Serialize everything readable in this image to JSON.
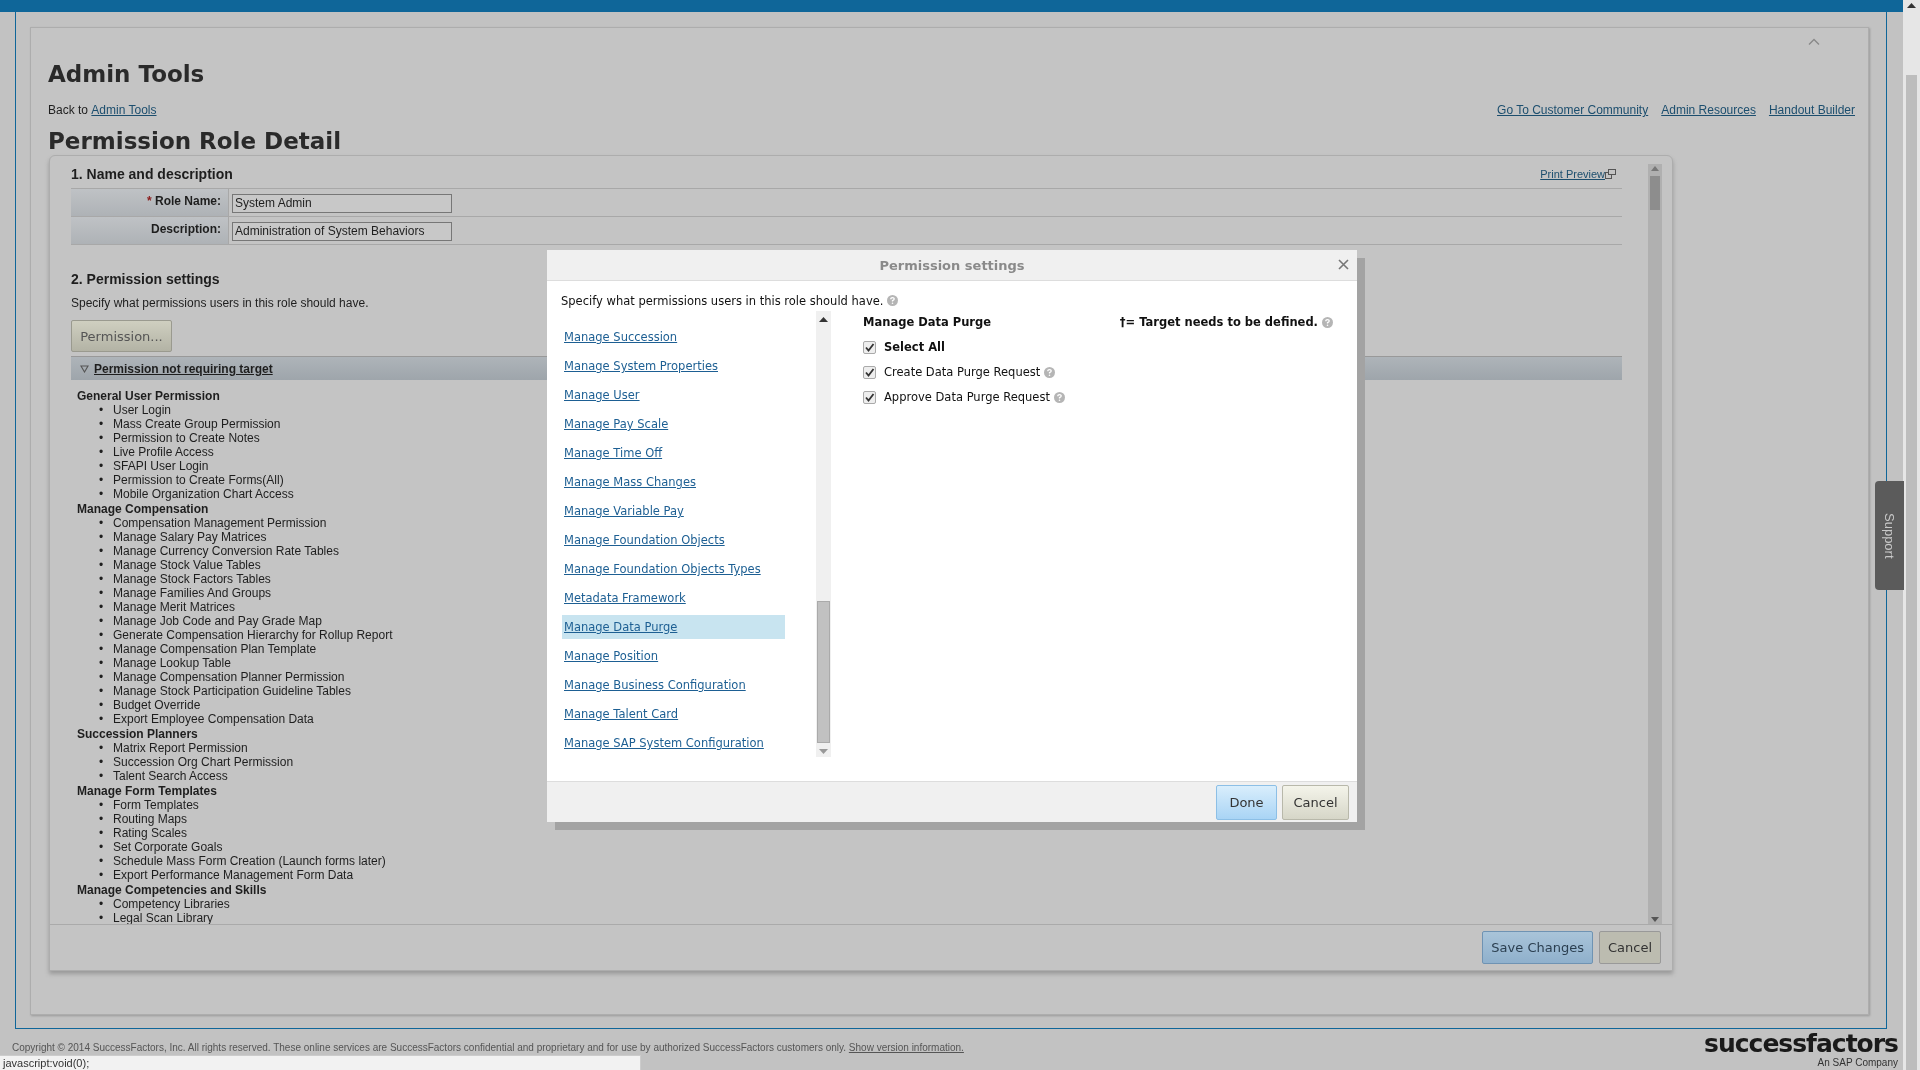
{
  "page_title": "Admin Tools",
  "nav": {
    "back_prefix": "Back to",
    "back_link": "Admin Tools",
    "links": [
      "Go To Customer Community",
      "Admin Resources",
      "Handout Builder"
    ]
  },
  "section_title": "Permission Role Detail",
  "role_form": {
    "heading": "1. Name and description",
    "print_preview": "Print Preview",
    "fields": [
      {
        "marker": "*",
        "label": "Role Name:",
        "value": "System Admin"
      },
      {
        "label": "Description:",
        "value": "Administration of System Behaviors"
      }
    ]
  },
  "permission_settings": {
    "heading": "2. Permission settings",
    "description": "Specify what permissions users in this role should have.",
    "button": "Permission...",
    "group_bar": {
      "label": "Permission not requiring target",
      "expanded": true
    },
    "bullet": "•",
    "groups": [
      {
        "name": "General User Permission",
        "items": [
          "User Login",
          "Mass Create Group Permission",
          "Permission to Create Notes",
          "Live Profile Access",
          "SFAPI User Login",
          "Permission to Create Forms(All)",
          "Mobile Organization Chart Access"
        ]
      },
      {
        "name": "Manage Compensation",
        "items": [
          "Compensation Management Permission",
          "Manage Salary Pay Matrices",
          "Manage Currency Conversion Rate Tables",
          "Manage Stock Value Tables",
          "Manage Stock Factors Tables",
          "Manage Families And Groups",
          "Manage Merit Matrices",
          "Manage Job Code and Pay Grade Map",
          "Generate Compensation Hierarchy for Rollup Report",
          "Manage Compensation Plan Template",
          "Manage Lookup Table",
          "Manage Compensation Planner Permission",
          "Manage Stock Participation Guideline Tables",
          "Budget Override",
          "Export Employee Compensation Data"
        ]
      },
      {
        "name": "Succession Planners",
        "items": [
          "Matrix Report Permission",
          "Succession Org Chart Permission",
          "Talent Search Access"
        ]
      },
      {
        "name": "Manage Form Templates",
        "items": [
          "Form Templates",
          "Routing Maps",
          "Rating Scales",
          "Set Corporate Goals",
          "Schedule Mass Form Creation (Launch forms later)",
          "Export Performance Management Form Data"
        ]
      },
      {
        "name": "Manage Competencies and Skills",
        "items": [
          "Competency Libraries",
          "Legal Scan Library"
        ]
      }
    ]
  },
  "footer_buttons": [
    "Save Changes",
    "Cancel"
  ],
  "dialog": {
    "title": "Permission settings",
    "description": "Specify what permissions users in this role should have.",
    "categories": [
      {
        "label": "Manage Succession",
        "selected": false
      },
      {
        "label": "Manage System Properties",
        "selected": false
      },
      {
        "label": "Manage User",
        "selected": false
      },
      {
        "label": "Manage Pay Scale",
        "selected": false
      },
      {
        "label": "Manage Time Off",
        "selected": false
      },
      {
        "label": "Manage Mass Changes",
        "selected": false
      },
      {
        "label": "Manage Variable Pay",
        "selected": false
      },
      {
        "label": "Manage Foundation Objects",
        "selected": false
      },
      {
        "label": "Manage Foundation Objects Types",
        "selected": false
      },
      {
        "label": "Metadata Framework",
        "selected": false
      },
      {
        "label": "Manage Data Purge",
        "selected": true
      },
      {
        "label": "Manage Position",
        "selected": false
      },
      {
        "label": "Manage Business Configuration",
        "selected": false
      },
      {
        "label": "Manage Talent Card",
        "selected": false
      },
      {
        "label": "Manage SAP System Configuration",
        "selected": false
      }
    ],
    "detail": {
      "title": "Manage Data Purge",
      "legend": "†= Target needs to be defined.",
      "options": [
        {
          "kind": "select-all",
          "label": "Select All",
          "checked": true
        },
        {
          "kind": "permission",
          "label": "Create Data Purge Request",
          "checked": true
        },
        {
          "kind": "permission",
          "label": "Approve Data Purge Request",
          "checked": true
        }
      ]
    },
    "buttons": [
      {
        "label": "Done",
        "primary": true
      },
      {
        "label": "Cancel",
        "primary": false
      }
    ]
  },
  "support_tab": "Support",
  "copyright": "Copyright © 2014 SuccessFactors, Inc. All rights reserved. These online services are SuccessFactors confidential and proprietary and for use by authorized SuccessFactors customers only.",
  "version_link": "Show version information.",
  "logo": {
    "name": "successfactors",
    "tagline": "An SAP Company"
  },
  "status_bar": "javascript:void(0);"
}
